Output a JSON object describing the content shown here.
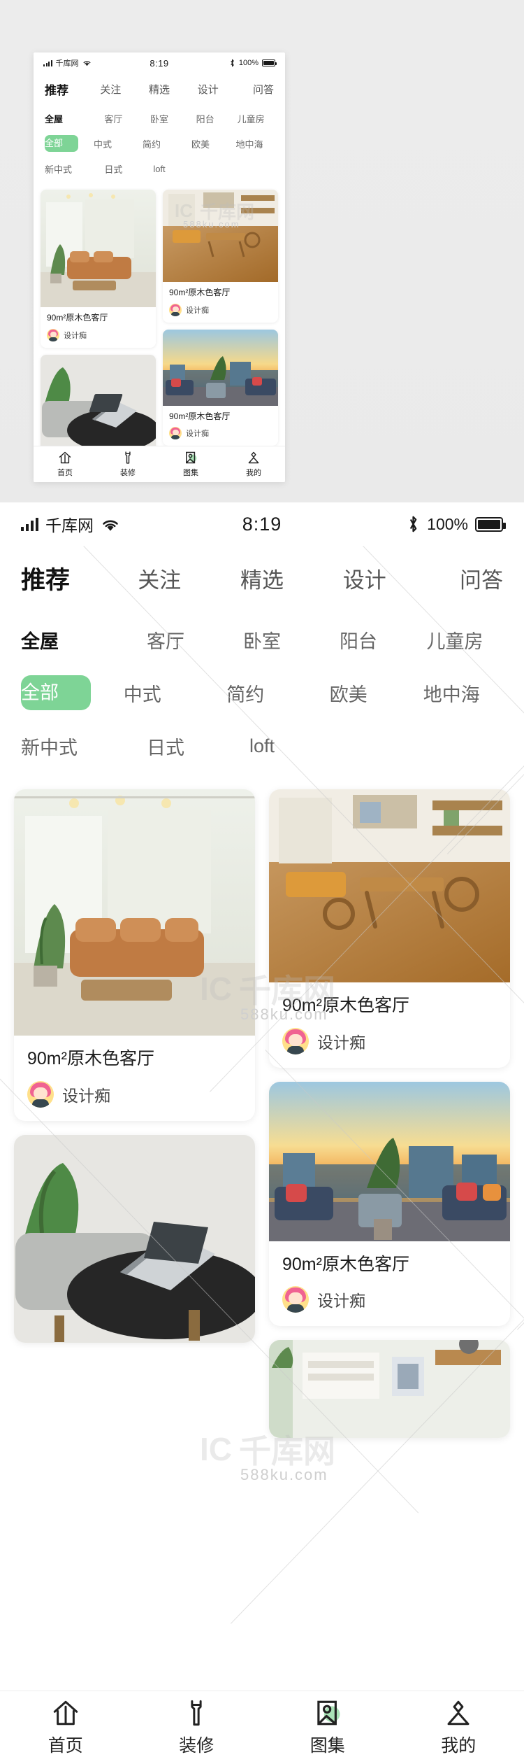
{
  "status_bar": {
    "carrier": "千库网",
    "time": "8:19",
    "battery_percent": "100%",
    "signal_icon": "signal-bars-icon",
    "wifi_icon": "wifi-icon",
    "bluetooth_icon": "bluetooth-icon",
    "battery_icon": "battery-full-icon"
  },
  "nav_tabs": [
    {
      "label": "推荐",
      "active": true
    },
    {
      "label": "关注",
      "active": false
    },
    {
      "label": "精选",
      "active": false
    },
    {
      "label": "设计",
      "active": false
    },
    {
      "label": "问答",
      "active": false
    }
  ],
  "filter_rows": [
    {
      "items": [
        {
          "label": "全屋",
          "state": "bold"
        },
        {
          "label": "客厅",
          "state": "normal"
        },
        {
          "label": "卧室",
          "state": "normal"
        },
        {
          "label": "阳台",
          "state": "normal"
        },
        {
          "label": "儿童房",
          "state": "normal"
        }
      ]
    },
    {
      "items": [
        {
          "label": "全部",
          "state": "pill"
        },
        {
          "label": "中式",
          "state": "normal"
        },
        {
          "label": "简约",
          "state": "normal"
        },
        {
          "label": "欧美",
          "state": "normal"
        },
        {
          "label": "地中海",
          "state": "normal"
        }
      ]
    },
    {
      "items": [
        {
          "label": "新中式",
          "state": "normal"
        },
        {
          "label": "日式",
          "state": "normal"
        },
        {
          "label": "loft",
          "state": "normal"
        }
      ]
    }
  ],
  "feed": {
    "left_column": [
      {
        "title": "90m²原木色客厅",
        "author": "设计痴",
        "image": "living-room-leather-sofa-photo",
        "image_height_ratio": 1.02
      },
      {
        "title": "",
        "author": "",
        "image": "desk-laptop-grey-chair-photo",
        "image_height_ratio": 0.86
      }
    ],
    "right_column": [
      {
        "title": "90m²原木色客厅",
        "author": "设计痴",
        "image": "wood-floor-dining-room-photo",
        "image_height_ratio": 0.8
      },
      {
        "title": "90m²原木色客厅",
        "author": "设计痴",
        "image": "rooftop-terrace-sunset-photo",
        "image_height_ratio": 0.66
      },
      {
        "title": "",
        "author": "",
        "image": "bookshelf-white-wall-photo",
        "image_height_ratio": 0.4
      }
    ]
  },
  "bottom_nav": [
    {
      "label": "首页",
      "icon": "home-icon",
      "active": false
    },
    {
      "label": "装修",
      "icon": "wrench-icon",
      "active": false
    },
    {
      "label": "图集",
      "icon": "gallery-image-icon",
      "active": true
    },
    {
      "label": "我的",
      "icon": "person-icon",
      "active": false
    }
  ],
  "watermark": {
    "brand": "千库网",
    "domain": "588ku.com",
    "glyph": "IC"
  },
  "colors": {
    "accent_green": "#7ed496",
    "text_primary": "#1a1a1a",
    "text_secondary": "#666666",
    "background": "#ececec",
    "card": "#ffffff"
  }
}
